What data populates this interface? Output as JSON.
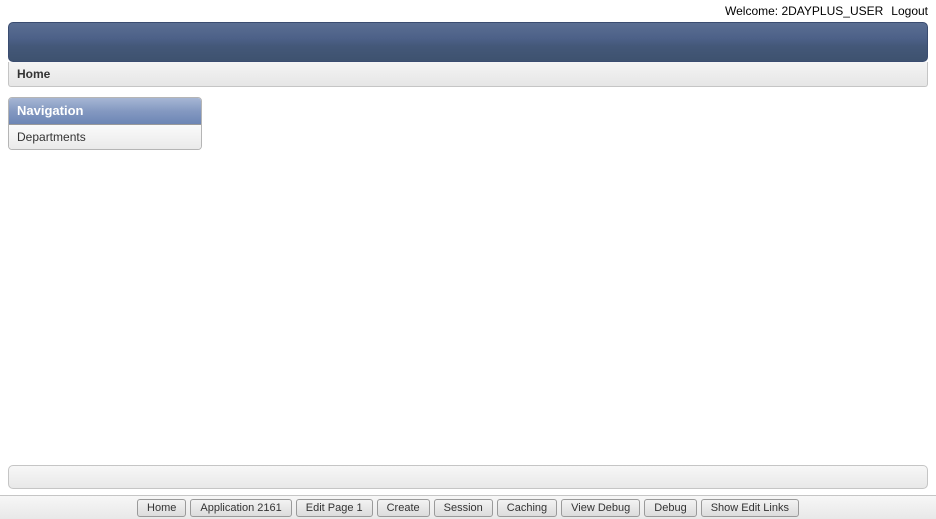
{
  "top": {
    "welcome_label": "Welcome: ",
    "username": "2DAYPLUS_USER",
    "logout": "Logout"
  },
  "breadcrumb": {
    "home": "Home"
  },
  "nav": {
    "title": "Navigation",
    "items": [
      {
        "label": "Departments"
      }
    ]
  },
  "dev_toolbar": {
    "home": "Home",
    "application": "Application 2161",
    "edit_page": "Edit Page 1",
    "create": "Create",
    "session": "Session",
    "caching": "Caching",
    "view_debug": "View Debug",
    "debug": "Debug",
    "show_edit_links": "Show Edit Links"
  }
}
